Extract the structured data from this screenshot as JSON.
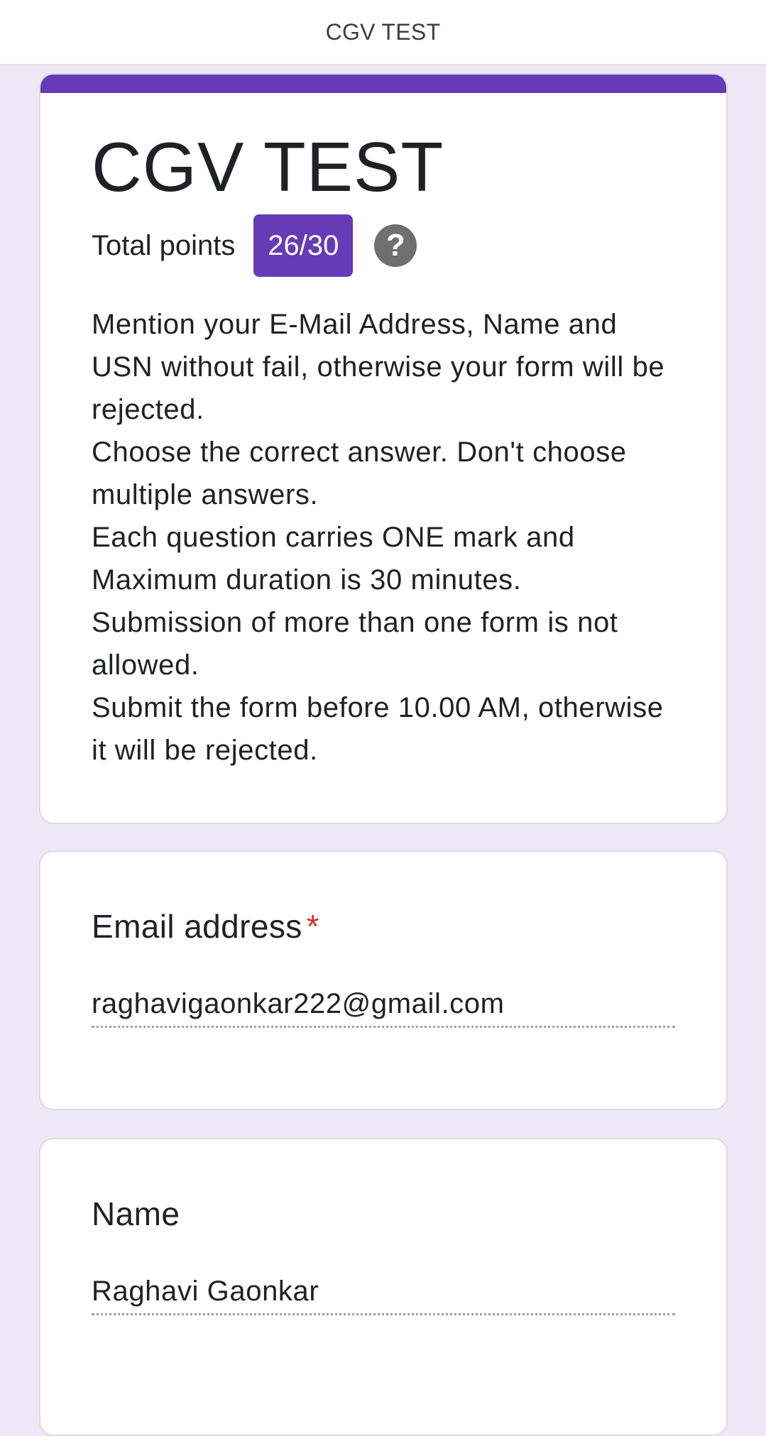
{
  "top_bar": {
    "title": "CGV TEST"
  },
  "header": {
    "title": "CGV TEST",
    "points_label": "Total points",
    "points_value": "26/30",
    "help_icon": "question-mark-icon",
    "accent_color": "#673ab7",
    "description": [
      "Mention your E-Mail Address, Name and USN without fail, otherwise your form will be rejected.",
      "Choose the correct answer. Don't choose multiple answers.",
      "Each question carries ONE mark and Maximum duration is 30 minutes.",
      "Submission of more than one form is not allowed.",
      "Submit the form before 10.00 AM, otherwise it will be rejected."
    ]
  },
  "questions": [
    {
      "title": "Email address",
      "required_marker": "*",
      "answer": "raghavigaonkar222@gmail.com"
    },
    {
      "title": "Name",
      "answer": "Raghavi Gaonkar"
    }
  ],
  "colors": {
    "page_background": "#ede7f6",
    "required": "#d93025"
  }
}
